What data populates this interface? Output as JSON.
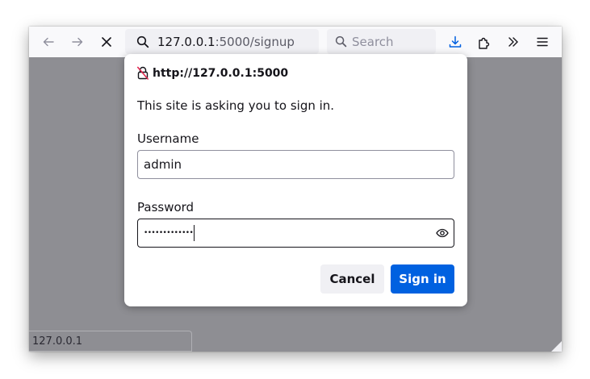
{
  "browser": {
    "url_host": "127.0.0.1",
    "url_path": ":5000/signup",
    "search_placeholder": "Search",
    "status_text": "127.0.0.1"
  },
  "dialog": {
    "origin": "http://127.0.0.1:5000",
    "message": "This site is asking you to sign in.",
    "username_label": "Username",
    "username_value": "admin",
    "password_label": "Password",
    "password_masked": "•••••••••••••",
    "cancel_label": "Cancel",
    "signin_label": "Sign in"
  },
  "icons": {
    "back": "back-arrow-icon",
    "forward": "forward-arrow-icon",
    "stop": "close-icon",
    "url_search": "search-icon",
    "search": "search-icon",
    "downloads": "download-icon",
    "extensions": "puzzle-icon",
    "overflow": "chevron-double-right-icon",
    "menu": "hamburger-menu-icon",
    "origin_lock": "insecure-lock-icon",
    "reveal_password": "eye-icon"
  },
  "colors": {
    "accent": "#0061e0",
    "download_icon": "#0060df",
    "insecure_lock": "#e22850",
    "page_overlay": "#8e8e93"
  }
}
